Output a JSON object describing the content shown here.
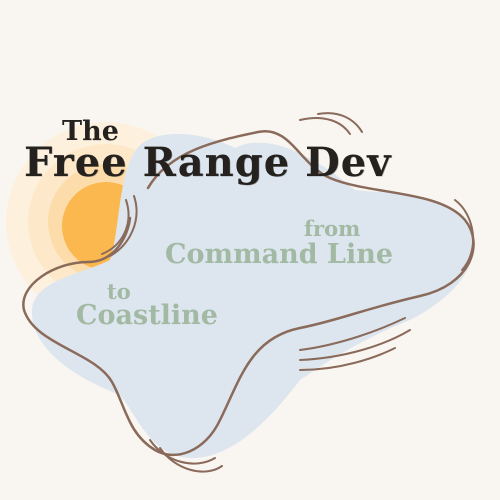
{
  "logo": {
    "title_prefix": "The",
    "title_main": "Free Range Dev",
    "tagline_from": "from",
    "tagline_command": "Command Line",
    "tagline_to": "to",
    "tagline_coast": "Coastline"
  },
  "colors": {
    "background": "#f9f6f1",
    "sun": "#fbb84e",
    "sun_glow": "#fde9c9",
    "blob": "#dde6ef",
    "outline": "#8a6a5a",
    "title_text": "#24211f",
    "tagline_text": "#a2b9a3"
  },
  "icons": {
    "sun": "sun-icon",
    "wave": "wave-outline-icon"
  }
}
